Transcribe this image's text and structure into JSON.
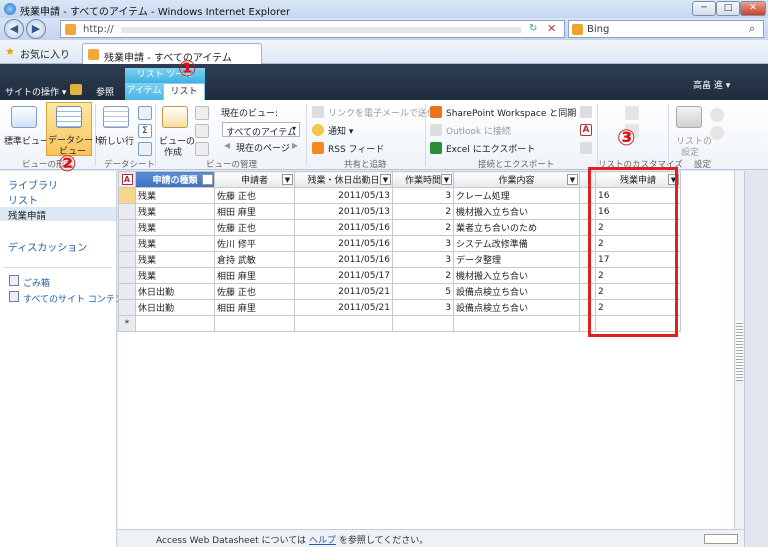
{
  "window": {
    "title": "残業申請 - すべてのアイテム - Windows Internet Explorer",
    "min": "─",
    "max": "□",
    "close": "✕"
  },
  "address_bar": {
    "url": "http://",
    "search_engine": "Bing"
  },
  "favorites": {
    "label": "お気に入り",
    "tab_title": "残業申請 - すべてのアイテム"
  },
  "sharepoint": {
    "site_actions": "サイトの操作",
    "browse_tab": "参照",
    "context_label": "リスト ツール",
    "tab_items": "アイテム",
    "tab_list": "リスト",
    "user": "高畠 進"
  },
  "ribbon": {
    "standard_view": "標準ビュー",
    "datasheet_view_1": "データシート",
    "datasheet_view_2": "ビュー",
    "new_row": "新しい行",
    "view_format_group": "ビューの形式",
    "datasheet_group": "データシート",
    "create_view_1": "ビューの",
    "create_view_2": "作成",
    "current_view_label": "現在のビュー:",
    "current_view_value": "すべてのアイテム",
    "current_page": "現在のページ",
    "manage_views_group": "ビューの管理",
    "email_link": "リンクを電子メールで送信",
    "alert": "通知",
    "rss": "RSS フィード",
    "share_group": "共有と追跡",
    "sp_workspace": "SharePoint Workspace と同期",
    "outlook": "Outlook に接続",
    "excel": "Excel にエクスポート",
    "connect_group": "接続とエクスポート",
    "customize_group": "リストのカスタマイズ",
    "list_settings_1": "リストの",
    "list_settings_2": "設定",
    "settings_group": "設定"
  },
  "left_nav": {
    "libraries": "ライブラリ",
    "lists": "リスト",
    "current": "残業申請",
    "discussions": "ディスカッション",
    "recycle_bin": "ごみ箱",
    "all_content": "すべてのサイト コンテンツ"
  },
  "grid": {
    "headers": [
      "申請の種類",
      "申請者",
      "残業・休日出勤日",
      "作業時間",
      "作業内容",
      "",
      "残業申請"
    ],
    "rows": [
      [
        "残業",
        "佐藤 正也",
        "2011/05/13",
        "3",
        "クレーム処理",
        "",
        "16"
      ],
      [
        "残業",
        "相田 麻里",
        "2011/05/13",
        "2",
        "機材搬入立ち合い",
        "",
        "16"
      ],
      [
        "残業",
        "佐藤 正也",
        "2011/05/16",
        "2",
        "業者立ち合いのため",
        "",
        "2"
      ],
      [
        "残業",
        "佐川 修平",
        "2011/05/16",
        "3",
        "システム改修準備",
        "",
        "2"
      ],
      [
        "残業",
        "倉持 武敏",
        "2011/05/16",
        "3",
        "データ整理",
        "",
        "17"
      ],
      [
        "残業",
        "相田 麻里",
        "2011/05/17",
        "2",
        "機材搬入立ち合い",
        "",
        "2"
      ],
      [
        "休日出勤",
        "佐藤 正也",
        "2011/05/21",
        "5",
        "設備点検立ち合い",
        "",
        "2"
      ],
      [
        "休日出勤",
        "相田 麻里",
        "2011/05/21",
        "3",
        "設備点検立ち合い",
        "",
        "2"
      ]
    ],
    "new_row_marker": "*"
  },
  "status_bar": {
    "prefix": "Access Web Datasheet については",
    "link": "ヘルプ",
    "suffix": "を参照してください。"
  },
  "annotations": {
    "one": "①",
    "two": "②",
    "three": "③"
  },
  "colors": {
    "accent": "#3fb1e0",
    "annotation": "#e02020"
  }
}
